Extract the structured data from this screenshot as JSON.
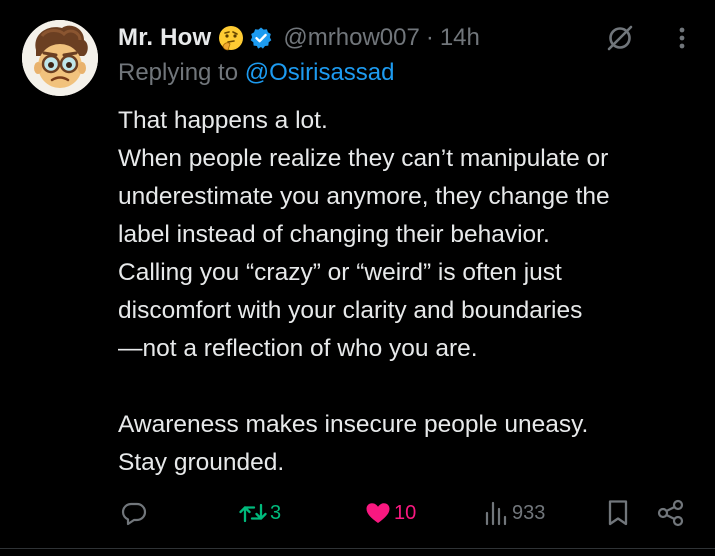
{
  "tweet": {
    "author": {
      "display_name": "Mr. How",
      "name_emoji": "thinking-face-emoji",
      "verified": true,
      "handle": "@mrhow007",
      "separator": "·",
      "time": "14h"
    },
    "reply": {
      "prefix": "Replying to ",
      "mention": "@Osirisassad"
    },
    "body": {
      "lines": [
        "That happens a lot.",
        "When people realize they can’t manipulate or",
        "underestimate you anymore, they change the",
        "label instead of changing their behavior.",
        "Calling you “crazy” or “weird” is often just",
        "discomfort with your clarity and boundaries",
        "—not a reflection of who you are.",
        "",
        "Awareness makes insecure people uneasy.",
        "Stay grounded."
      ]
    },
    "actions": {
      "reply_count": "",
      "repost_count": "3",
      "like_count": "10",
      "views_count": "933"
    }
  },
  "icons": {
    "reply": "reply-icon",
    "repost": "repost-icon",
    "like": "heart-icon",
    "views": "views-icon",
    "bookmark": "bookmark-icon",
    "share": "share-icon",
    "grok": "grok-icon",
    "more": "more-icon",
    "verified": "verified-badge-icon"
  },
  "colors": {
    "background": "#000000",
    "text": "#e7e9ea",
    "muted": "#71767b",
    "accent": "#1d9bf0",
    "repost": "#00ba7c",
    "like": "#f91880"
  }
}
